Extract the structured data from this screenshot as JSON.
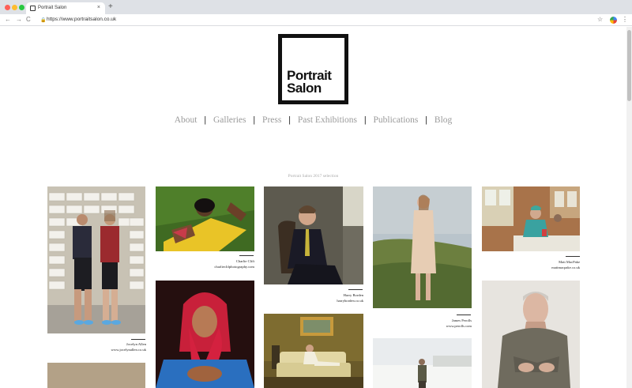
{
  "browser": {
    "tab_title": "Portrait Salon",
    "tab_close": "×",
    "new_tab": "+",
    "url": "https://www.portraitsalon.co.uk",
    "back_icon": "←",
    "forward_icon": "→",
    "reload_icon": "C",
    "star_icon": "☆",
    "menu_icon": "⋮"
  },
  "logo": {
    "line1": "Portrait",
    "line2": "Salon"
  },
  "nav": [
    "About",
    "Galleries",
    "Press",
    "Past Exhibitions",
    "Publications",
    "Blog"
  ],
  "section_caption": "Portrait Salon 2017 selection",
  "photos": [
    {
      "name": "Jocelyn Allen",
      "site": "www.jocelynallen.co.uk"
    },
    {
      "name": "Charlie Clift",
      "site": "charlieclifphotography.com"
    },
    {
      "name": "Harry Borden",
      "site": "harryborden.co.uk"
    },
    {
      "name": "James Perolls",
      "site": "www.perolls.com"
    },
    {
      "name": "Matt MacPake",
      "site": "mattmacpake.co.uk"
    }
  ]
}
